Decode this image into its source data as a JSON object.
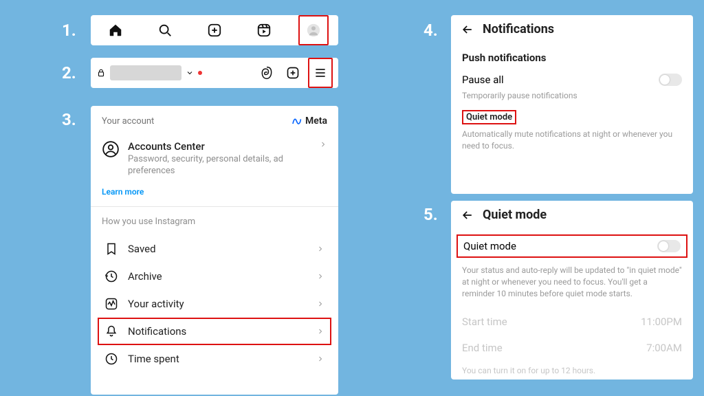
{
  "steps": [
    "1.",
    "2.",
    "3.",
    "4.",
    "5."
  ],
  "s1": {
    "icons": [
      "home",
      "search",
      "create",
      "reels",
      "profile"
    ]
  },
  "s2": {
    "icons": [
      "lock",
      "chevron-down",
      "threads",
      "create",
      "menu"
    ]
  },
  "s3": {
    "your_account": "Your account",
    "meta": "Meta",
    "accounts_center": {
      "title": "Accounts Center",
      "subtitle": "Password, security, personal details, ad preferences"
    },
    "learn_more": "Learn more",
    "section": "How you use Instagram",
    "items": [
      {
        "label": "Saved"
      },
      {
        "label": "Archive"
      },
      {
        "label": "Your activity"
      },
      {
        "label": "Notifications",
        "highlighted": true
      },
      {
        "label": "Time spent"
      }
    ]
  },
  "s4": {
    "title": "Notifications",
    "push_header": "Push notifications",
    "pause_all": "Pause all",
    "pause_hint": "Temporarily pause notifications",
    "quiet_mode": "Quiet mode",
    "quiet_hint": "Automatically mute notifications at night or whenever you need to focus."
  },
  "s5": {
    "title": "Quiet mode",
    "row": "Quiet mode",
    "desc": "Your status and auto-reply will be updated to \"in quiet mode\" at night or whenever you need to focus. You'll get a reminder 10 minutes before quiet mode starts.",
    "start_label": "Start time",
    "start_value": "11:00PM",
    "end_label": "End time",
    "end_value": "7:00AM",
    "footer": "You can turn it on for up to 12 hours."
  }
}
